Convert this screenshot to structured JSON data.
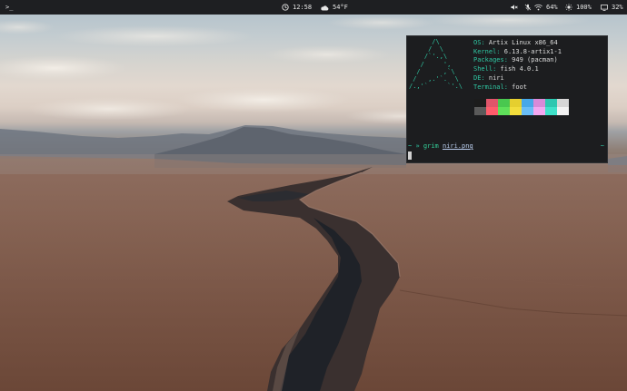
{
  "topbar": {
    "launcher": ">_",
    "clock": "12:58",
    "weather": "54°F",
    "battery": "64%",
    "brightness": "100%",
    "display": "32%"
  },
  "terminal": {
    "ascii_logo": "      /\\\n     /  \\\n    /`'.,\\\n   /     ',\n  /      ,`\\\n /   ,.'`.  \\\n/.,'`     `'.\\",
    "info": [
      {
        "key": "OS",
        "value": "Artix Linux x86_64"
      },
      {
        "key": "Kernel",
        "value": "6.13.8-artix1-1"
      },
      {
        "key": "Packages",
        "value": "949 (pacman)"
      },
      {
        "key": "Shell",
        "value": "fish 4.0.1"
      },
      {
        "key": "DE",
        "value": "niri"
      },
      {
        "key": "Terminal",
        "value": "foot"
      }
    ],
    "palette": [
      "#1c1c1c",
      "#e0556a",
      "#49c84f",
      "#e5cf2f",
      "#47a8e8",
      "#d88ad8",
      "#2dc7b0",
      "#d6d6d6",
      "#5a5a5a",
      "#ff5c6b",
      "#5fe05a",
      "#f2dd3c",
      "#69bdf5",
      "#f3a7f0",
      "#3fe1c9",
      "#f2f2f2"
    ],
    "prompt": {
      "tilde": "~",
      "arrow": "»",
      "command": "grim",
      "argument": "niri.png",
      "right": "~"
    }
  },
  "colors": {
    "accent": "#2fc7a3",
    "bar": "#1e1f22",
    "terminal_bg": "#1c1d1f"
  }
}
